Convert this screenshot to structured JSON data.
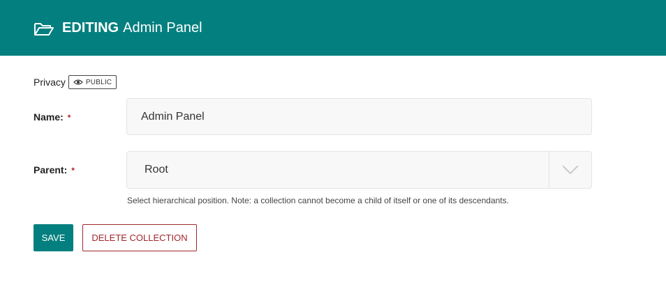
{
  "header": {
    "icon": "folder-open-icon",
    "editing_label": "EDITING",
    "title": "Admin Panel",
    "background_color": "#047f7f"
  },
  "privacy": {
    "label": "Privacy",
    "badge": "PUBLIC",
    "badge_icon": "eye-icon"
  },
  "form": {
    "name": {
      "label": "Name:",
      "required_mark": "*",
      "value": "Admin Panel"
    },
    "parent": {
      "label": "Parent:",
      "required_mark": "*",
      "selected": "Root",
      "dropdown_icon": "chevron-down-icon",
      "help": "Select hierarchical position. Note: a collection cannot become a child of itself or one of its descendants."
    }
  },
  "actions": {
    "save_label": "SAVE",
    "delete_label": "DELETE COLLECTION",
    "accent_color": "#047f7f",
    "danger_color": "#a0272c"
  }
}
